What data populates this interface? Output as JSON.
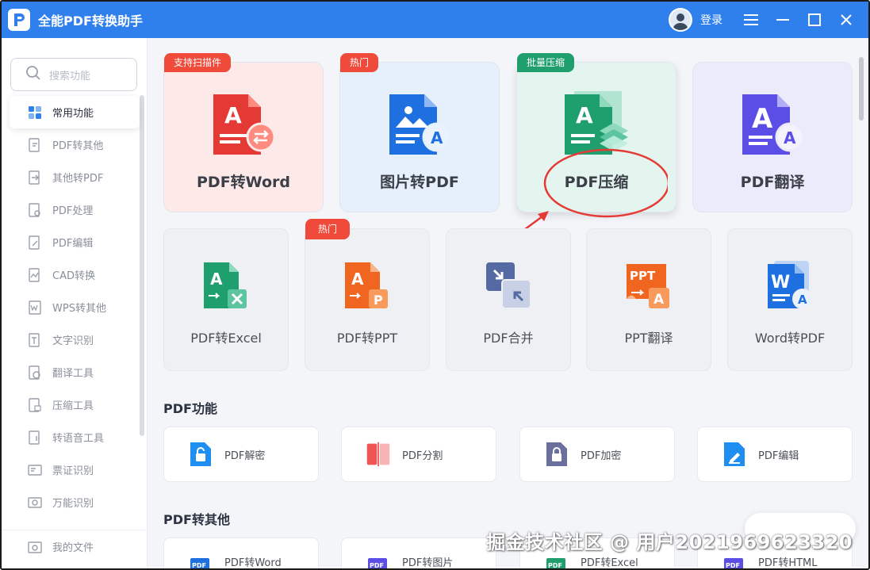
{
  "app": {
    "title": "全能PDF转换助手",
    "login_label": "登录"
  },
  "search": {
    "placeholder": "搜索功能"
  },
  "sidebar": {
    "items": [
      {
        "label": "常用功能",
        "icon": "grid-icon",
        "active": true
      },
      {
        "label": "PDF转其他",
        "icon": "pdf-export-icon"
      },
      {
        "label": "其他转PDF",
        "icon": "pdf-import-icon"
      },
      {
        "label": "PDF处理",
        "icon": "pdf-process-icon"
      },
      {
        "label": "PDF编辑",
        "icon": "pdf-edit-icon"
      },
      {
        "label": "CAD转换",
        "icon": "cad-icon"
      },
      {
        "label": "WPS转其他",
        "icon": "wps-icon"
      },
      {
        "label": "文字识别",
        "icon": "ocr-icon"
      },
      {
        "label": "翻译工具",
        "icon": "translate-icon"
      },
      {
        "label": "压缩工具",
        "icon": "compress-icon"
      },
      {
        "label": "转语音工具",
        "icon": "voice-icon"
      },
      {
        "label": "票证识别",
        "icon": "ticket-icon"
      },
      {
        "label": "万能识别",
        "icon": "scan-icon"
      }
    ],
    "bottom_item": {
      "label": "我的文件",
      "icon": "folder-icon"
    }
  },
  "featured": [
    {
      "title": "PDF转Word",
      "badge": "支持扫描件",
      "badge_color": "#ef4a3a",
      "bg": "#fde9e8"
    },
    {
      "title": "图片转PDF",
      "badge": "热门",
      "badge_color": "#ef4a3a",
      "bg": "#e6f0fd"
    },
    {
      "title": "PDF压缩",
      "badge": "批量压缩",
      "badge_color": "#1f9f6e",
      "bg": "#e3f5ee"
    },
    {
      "title": "PDF翻译",
      "badge": "",
      "badge_color": "",
      "bg": "#ecebfb"
    }
  ],
  "tools": [
    {
      "title": "PDF转Excel",
      "badge": ""
    },
    {
      "title": "PDF转PPT",
      "badge": "热门"
    },
    {
      "title": "PDF合并",
      "badge": ""
    },
    {
      "title": "PPT翻译",
      "badge": ""
    },
    {
      "title": "Word转PDF",
      "badge": ""
    }
  ],
  "sections": {
    "pdf_functions": {
      "title": "PDF功能",
      "items": [
        "PDF解密",
        "PDF分割",
        "PDF加密",
        "PDF编辑"
      ]
    },
    "pdf_to_other": {
      "title": "PDF转其他",
      "items": [
        "PDF转Word",
        "PDF转图片",
        "PDF转Excel",
        "PDF转HTML"
      ]
    }
  },
  "watermark": "掘金技术社区 @ 用户2021969623320",
  "colors": {
    "titlebar": "#2f80ed",
    "accent": "#2f80ed",
    "annotation": "#e53935"
  }
}
